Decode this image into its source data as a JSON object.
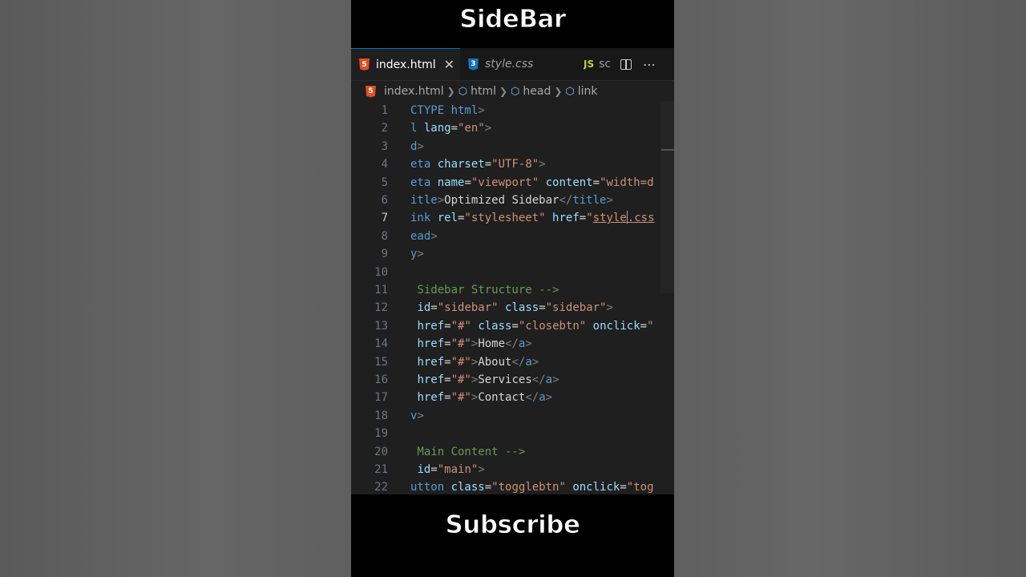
{
  "captions": {
    "top": "SideBar",
    "bottom": "Subscribe"
  },
  "tabs": [
    {
      "label": "index.html",
      "icon": "html5-icon",
      "active": true,
      "close": "✕"
    },
    {
      "label": "style.css",
      "icon": "css3-icon",
      "active": false
    },
    {
      "label": "sc",
      "icon": "javascript-icon",
      "icon_text": "JS",
      "active": false
    }
  ],
  "icons": {
    "html": "5",
    "css": "3"
  },
  "breadcrumb": [
    "index.html",
    "html",
    "head",
    "link"
  ],
  "colors": {
    "tag": "#569cd6",
    "attr": "#9cdcfe",
    "string": "#ce9178",
    "comment": "#6a9955",
    "text": "#d4d4d4",
    "accent": "#0078d4"
  },
  "code": {
    "current_line": 7,
    "lines": [
      {
        "n": 1,
        "tokens": [
          [
            "t-tag",
            "CTYPE html"
          ],
          [
            "t-punc",
            ">"
          ]
        ]
      },
      {
        "n": 2,
        "tokens": [
          [
            "t-tag",
            "l "
          ],
          [
            "t-attr",
            "lang"
          ],
          [
            "t-text",
            "="
          ],
          [
            "t-str",
            "\"en\""
          ],
          [
            "t-punc",
            ">"
          ]
        ]
      },
      {
        "n": 3,
        "tokens": [
          [
            "t-tag",
            "d"
          ],
          [
            "t-punc",
            ">"
          ]
        ]
      },
      {
        "n": 4,
        "tokens": [
          [
            "t-tag",
            "eta "
          ],
          [
            "t-attr",
            "charset"
          ],
          [
            "t-text",
            "="
          ],
          [
            "t-str",
            "\"UTF-8\""
          ],
          [
            "t-punc",
            ">"
          ]
        ]
      },
      {
        "n": 5,
        "tokens": [
          [
            "t-tag",
            "eta "
          ],
          [
            "t-attr",
            "name"
          ],
          [
            "t-text",
            "="
          ],
          [
            "t-str",
            "\"viewport\""
          ],
          [
            "t-text",
            " "
          ],
          [
            "t-attr",
            "content"
          ],
          [
            "t-text",
            "="
          ],
          [
            "t-str",
            "\"width=d"
          ]
        ]
      },
      {
        "n": 6,
        "tokens": [
          [
            "t-tag",
            "itle"
          ],
          [
            "t-punc",
            ">"
          ],
          [
            "t-text",
            "Optimized Sidebar"
          ],
          [
            "t-punc",
            "</"
          ],
          [
            "t-tag",
            "title"
          ],
          [
            "t-punc",
            ">"
          ]
        ]
      },
      {
        "n": 7,
        "tokens": [
          [
            "t-tag",
            "ink "
          ],
          [
            "t-attr",
            "rel"
          ],
          [
            "t-text",
            "="
          ],
          [
            "t-str",
            "\"stylesheet\""
          ],
          [
            "t-text",
            " "
          ],
          [
            "t-attr",
            "href"
          ],
          [
            "t-text",
            "="
          ],
          [
            "t-str",
            "\""
          ],
          [
            "t-str underline",
            "style"
          ],
          [
            "cursor",
            ""
          ],
          [
            "t-str underline",
            ".css"
          ]
        ]
      },
      {
        "n": 8,
        "tokens": [
          [
            "t-tag",
            "ead"
          ],
          [
            "t-punc",
            ">"
          ]
        ]
      },
      {
        "n": 9,
        "tokens": [
          [
            "t-tag",
            "y"
          ],
          [
            "t-punc",
            ">"
          ]
        ]
      },
      {
        "n": 10,
        "tokens": []
      },
      {
        "n": 11,
        "tokens": [
          [
            "t-com",
            " Sidebar Structure -->"
          ]
        ]
      },
      {
        "n": 12,
        "tokens": [
          [
            "t-tag",
            " "
          ],
          [
            "t-attr",
            "id"
          ],
          [
            "t-text",
            "="
          ],
          [
            "t-str",
            "\"sidebar\""
          ],
          [
            "t-text",
            " "
          ],
          [
            "t-attr",
            "class"
          ],
          [
            "t-text",
            "="
          ],
          [
            "t-str",
            "\"sidebar\""
          ],
          [
            "t-punc",
            ">"
          ]
        ]
      },
      {
        "n": 13,
        "tokens": [
          [
            "t-tag",
            " "
          ],
          [
            "t-attr",
            "href"
          ],
          [
            "t-text",
            "="
          ],
          [
            "t-str",
            "\"#\""
          ],
          [
            "t-text",
            " "
          ],
          [
            "t-attr",
            "class"
          ],
          [
            "t-text",
            "="
          ],
          [
            "t-str",
            "\"closebtn\""
          ],
          [
            "t-text",
            " "
          ],
          [
            "t-attr",
            "onclick"
          ],
          [
            "t-text",
            "="
          ],
          [
            "t-str",
            "\""
          ]
        ]
      },
      {
        "n": 14,
        "tokens": [
          [
            "t-tag",
            " "
          ],
          [
            "t-attr",
            "href"
          ],
          [
            "t-text",
            "="
          ],
          [
            "t-str",
            "\"#\""
          ],
          [
            "t-punc",
            ">"
          ],
          [
            "t-text",
            "Home"
          ],
          [
            "t-punc",
            "</"
          ],
          [
            "t-tag",
            "a"
          ],
          [
            "t-punc",
            ">"
          ]
        ]
      },
      {
        "n": 15,
        "tokens": [
          [
            "t-tag",
            " "
          ],
          [
            "t-attr",
            "href"
          ],
          [
            "t-text",
            "="
          ],
          [
            "t-str",
            "\"#\""
          ],
          [
            "t-punc",
            ">"
          ],
          [
            "t-text",
            "About"
          ],
          [
            "t-punc",
            "</"
          ],
          [
            "t-tag",
            "a"
          ],
          [
            "t-punc",
            ">"
          ]
        ]
      },
      {
        "n": 16,
        "tokens": [
          [
            "t-tag",
            " "
          ],
          [
            "t-attr",
            "href"
          ],
          [
            "t-text",
            "="
          ],
          [
            "t-str",
            "\"#\""
          ],
          [
            "t-punc",
            ">"
          ],
          [
            "t-text",
            "Services"
          ],
          [
            "t-punc",
            "</"
          ],
          [
            "t-tag",
            "a"
          ],
          [
            "t-punc",
            ">"
          ]
        ]
      },
      {
        "n": 17,
        "tokens": [
          [
            "t-tag",
            " "
          ],
          [
            "t-attr",
            "href"
          ],
          [
            "t-text",
            "="
          ],
          [
            "t-str",
            "\"#\""
          ],
          [
            "t-punc",
            ">"
          ],
          [
            "t-text",
            "Contact"
          ],
          [
            "t-punc",
            "</"
          ],
          [
            "t-tag",
            "a"
          ],
          [
            "t-punc",
            ">"
          ]
        ]
      },
      {
        "n": 18,
        "tokens": [
          [
            "t-tag",
            "v"
          ],
          [
            "t-punc",
            ">"
          ]
        ]
      },
      {
        "n": 19,
        "tokens": []
      },
      {
        "n": 20,
        "tokens": [
          [
            "t-com",
            " Main Content -->"
          ]
        ]
      },
      {
        "n": 21,
        "tokens": [
          [
            "t-tag",
            " "
          ],
          [
            "t-attr",
            "id"
          ],
          [
            "t-text",
            "="
          ],
          [
            "t-str",
            "\"main\""
          ],
          [
            "t-punc",
            ">"
          ]
        ]
      },
      {
        "n": 22,
        "tokens": [
          [
            "t-tag",
            "utton "
          ],
          [
            "t-attr",
            "class"
          ],
          [
            "t-text",
            "="
          ],
          [
            "t-str",
            "\"togglebtn\""
          ],
          [
            "t-text",
            " "
          ],
          [
            "t-attr",
            "onclick"
          ],
          [
            "t-text",
            "="
          ],
          [
            "t-str",
            "\"tog"
          ]
        ]
      }
    ]
  }
}
